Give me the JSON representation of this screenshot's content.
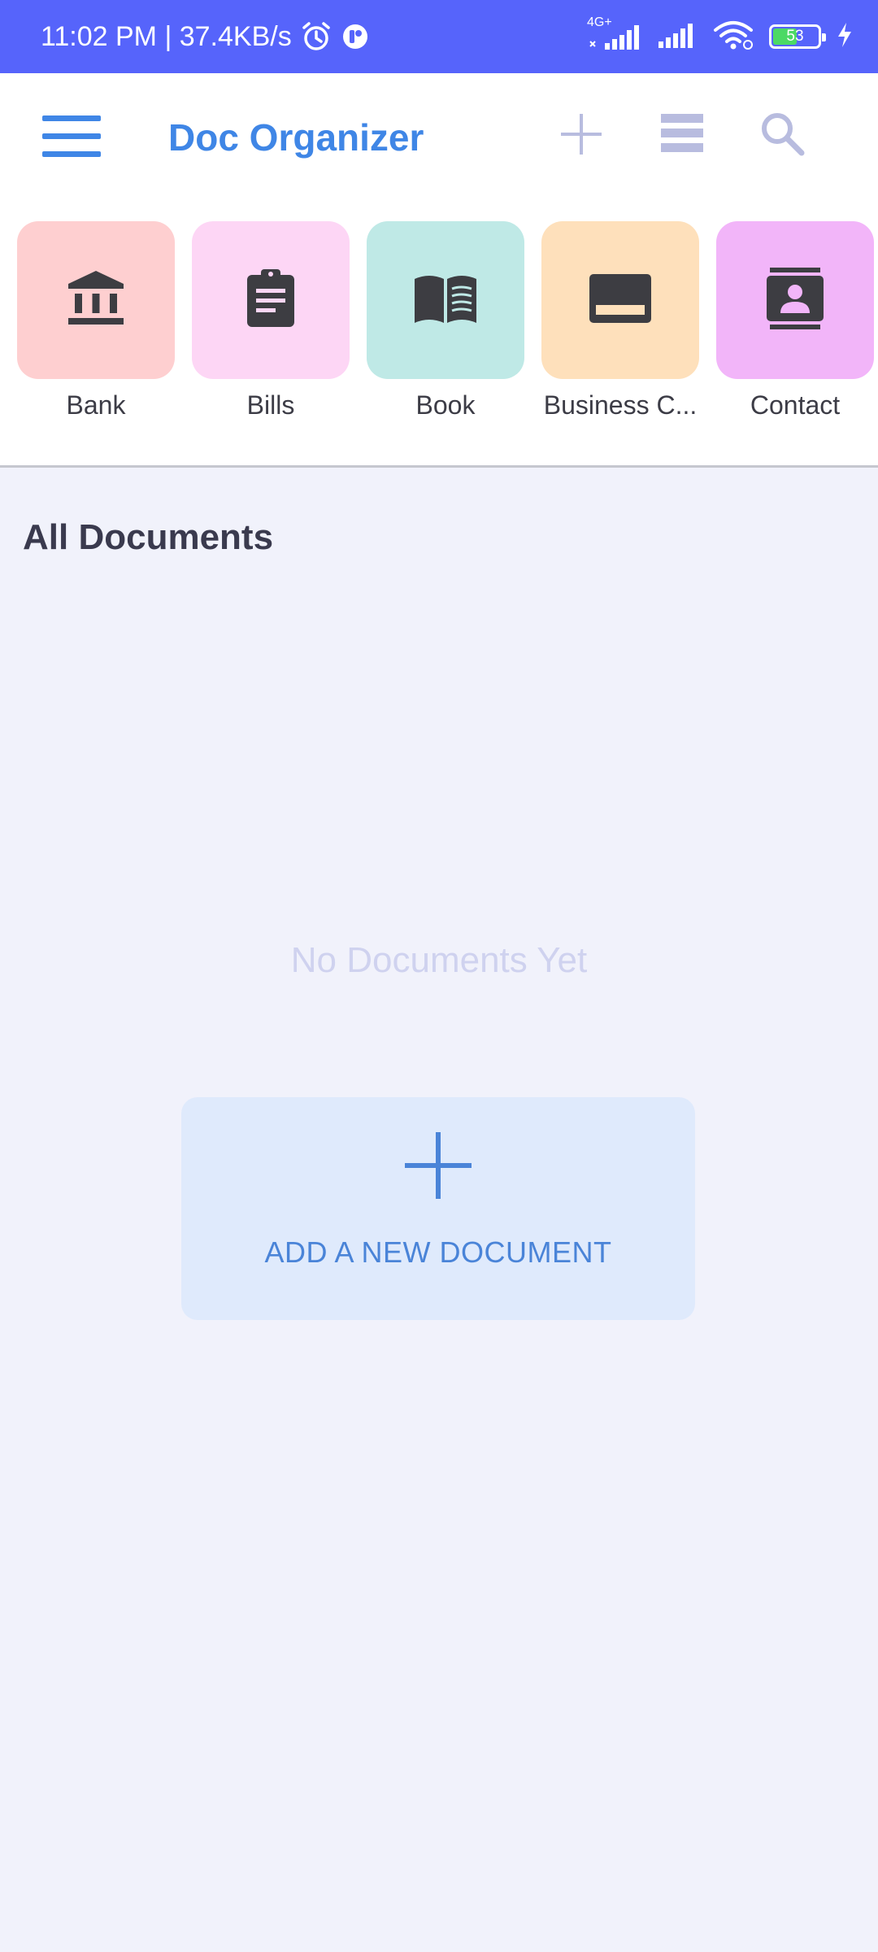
{
  "status_bar": {
    "time_speed": "11:02 PM | 37.4KB/s",
    "network_type": "4G+",
    "battery_level": "53",
    "icons": [
      "alarm-icon",
      "app-notification-icon",
      "signal-icon",
      "signal-icon-2",
      "wifi-icon",
      "battery-icon",
      "charging-icon"
    ]
  },
  "appbar": {
    "title": "Doc Organizer",
    "icons": [
      "menu-icon",
      "add-icon",
      "view-list-icon",
      "search-icon"
    ]
  },
  "categories": [
    {
      "label": "Bank",
      "icon": "bank-icon",
      "color": "#fecfd0"
    },
    {
      "label": "Bills",
      "icon": "clipboard-icon",
      "color": "#fdd6f5"
    },
    {
      "label": "Book",
      "icon": "book-icon",
      "color": "#bfe9e6"
    },
    {
      "label": "Business C...",
      "icon": "card-icon",
      "color": "#fee0bb"
    },
    {
      "label": "Contact",
      "icon": "contact-icon",
      "color": "#f2b5f9"
    }
  ],
  "main": {
    "section_title": "All Documents",
    "empty_message": "No Documents Yet",
    "add_button_label": "ADD A NEW DOCUMENT"
  },
  "colors": {
    "status_bar": "#5664fb",
    "accent": "#3f86e6",
    "background": "#f1f2fb",
    "add_button_bg": "#dfeafc"
  }
}
